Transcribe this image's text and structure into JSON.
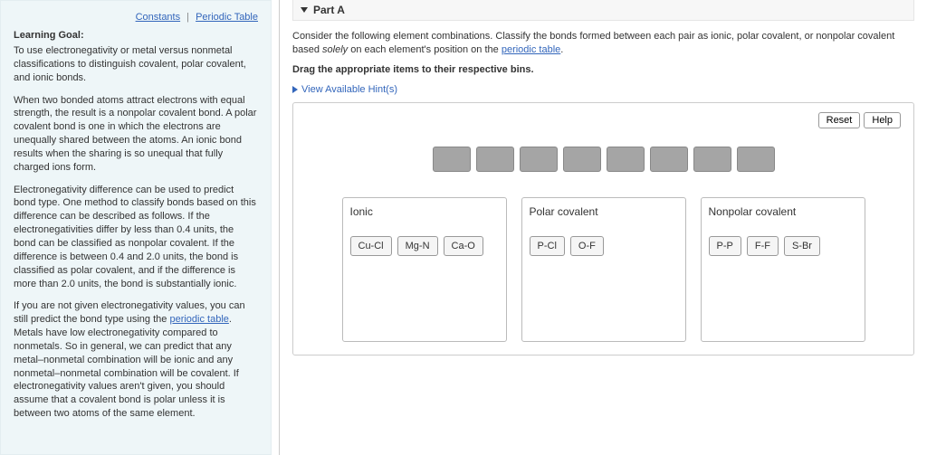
{
  "sidebar": {
    "links": {
      "constants": "Constants",
      "periodic": "Periodic Table"
    },
    "learning_goal_label": "Learning Goal:",
    "p1": "To use electronegativity or metal versus nonmetal classifications to distinguish covalent, polar covalent, and ionic bonds.",
    "p2": "When two bonded atoms attract electrons with equal strength, the result is a nonpolar covalent bond. A polar covalent bond is one in which the electrons are unequally shared between the atoms. An ionic bond results when the sharing is so unequal that fully charged ions form.",
    "p3": "Electronegativity difference can be used to predict bond type.  One method to classify bonds based on this difference can be described as follows. If the electronegativities differ by less than 0.4 units, the bond can be classified as nonpolar covalent.  If the difference is between 0.4 and 2.0 units,  the bond is classified as polar covalent, and if the difference is more than 2.0 units, the bond is substantially ionic.",
    "p4a": "If you are not given electronegativity values, you can still predict the bond type using the ",
    "p4link": "periodic table",
    "p4b": ". Metals have low electronegativity compared to nonmetals. So in general, we can predict that any metal–nonmetal combination will be ionic and any nonmetal–nonmetal combination will be covalent. If electronegativity values aren't given, you should assume that a covalent bond is polar unless it is between two atoms of the same element."
  },
  "main": {
    "part_label": "Part A",
    "instr1a": "Consider the following element combinations. Classify the bonds formed between each pair as ionic, polar covalent, or nonpolar covalent based ",
    "instr1i": "solely",
    "instr1b": " on each element's position on the ",
    "instr1link": "periodic table",
    "instr1c": ".",
    "instr2": "Drag the appropriate items to their respective bins.",
    "hints": "View Available Hint(s)",
    "reset": "Reset",
    "help": "Help",
    "pool_count": 8,
    "bins": [
      {
        "title": "Ionic",
        "items": [
          "Cu-Cl",
          "Mg-N",
          "Ca-O"
        ]
      },
      {
        "title": "Polar covalent",
        "items": [
          "P-Cl",
          "O-F"
        ]
      },
      {
        "title": "Nonpolar covalent",
        "items": [
          "P-P",
          "F-F",
          "S-Br"
        ]
      }
    ]
  }
}
